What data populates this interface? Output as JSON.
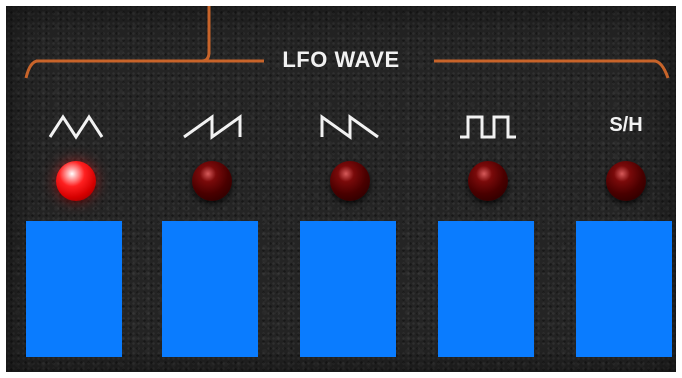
{
  "section": {
    "label": "LFO WAVE"
  },
  "colors": {
    "panel": "#242424",
    "bracket": "#c8642a",
    "text": "#f2f2f2",
    "button": "#0a7cff",
    "led_on": "#ff2020",
    "led_off": "#4a0000"
  },
  "waveforms": [
    {
      "icon": "triangle-wave-icon",
      "label": "",
      "led_on": true
    },
    {
      "icon": "sawtooth-up-wave-icon",
      "label": "",
      "led_on": false
    },
    {
      "icon": "sawtooth-down-wave-icon",
      "label": "",
      "led_on": false
    },
    {
      "icon": "square-wave-icon",
      "label": "",
      "led_on": false
    },
    {
      "icon": "sample-hold-icon",
      "label": "S/H",
      "led_on": false
    }
  ]
}
